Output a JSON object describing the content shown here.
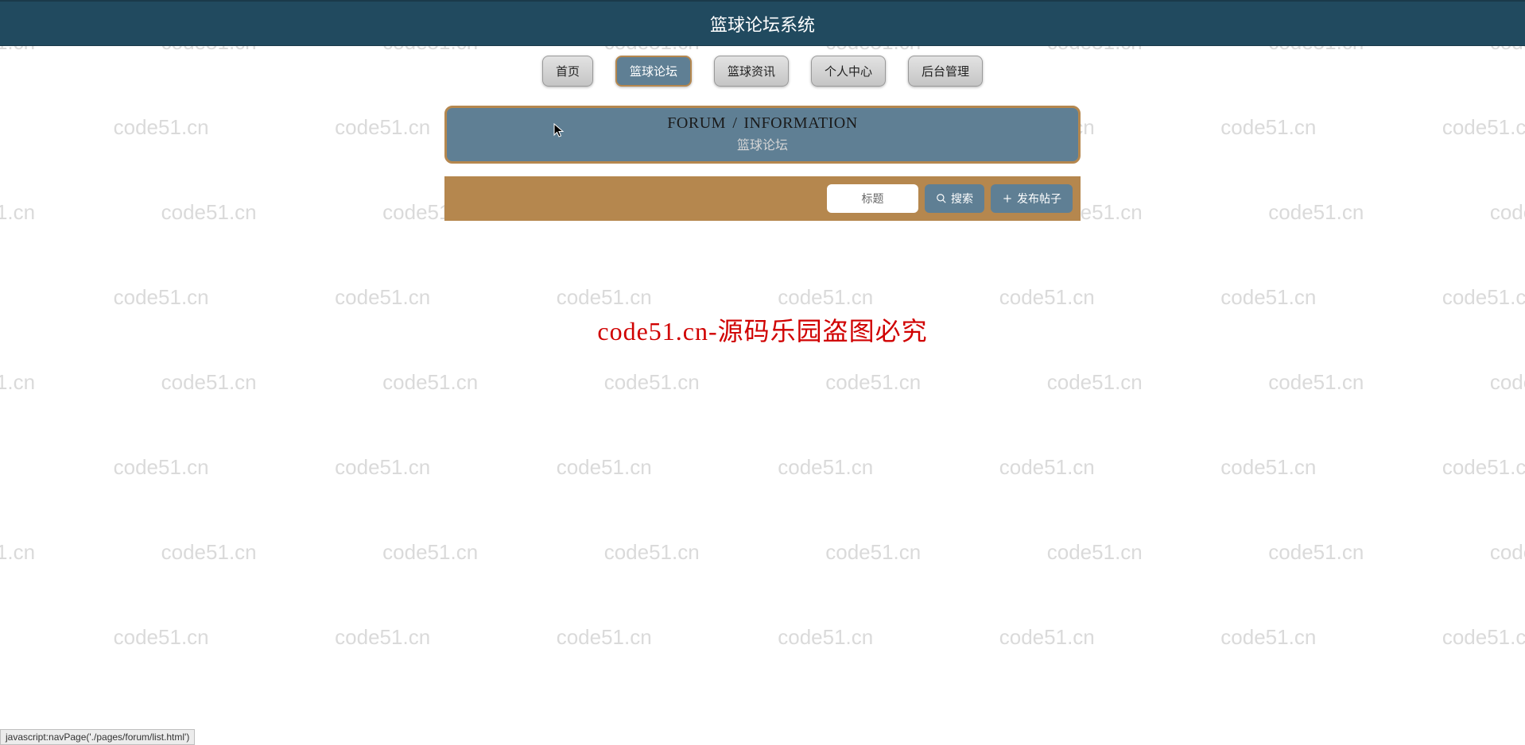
{
  "header": {
    "title": "篮球论坛系统"
  },
  "nav": {
    "items": [
      {
        "label": "首页",
        "active": false
      },
      {
        "label": "篮球论坛",
        "active": true
      },
      {
        "label": "篮球资讯",
        "active": false
      },
      {
        "label": "个人中心",
        "active": false
      },
      {
        "label": "后台管理",
        "active": false
      }
    ]
  },
  "banner": {
    "en_left": "FORUM",
    "separator": "/",
    "en_right": "INFORMATION",
    "cn": "篮球论坛"
  },
  "toolbar": {
    "search_placeholder": "标题",
    "search_label": "搜索",
    "post_label": "发布帖子"
  },
  "watermark": {
    "repeat_text": "code51.cn",
    "center_text": "code51.cn-源码乐园盗图必究"
  },
  "status_bar": {
    "text": "javascript:navPage('./pages/forum/list.html')"
  }
}
